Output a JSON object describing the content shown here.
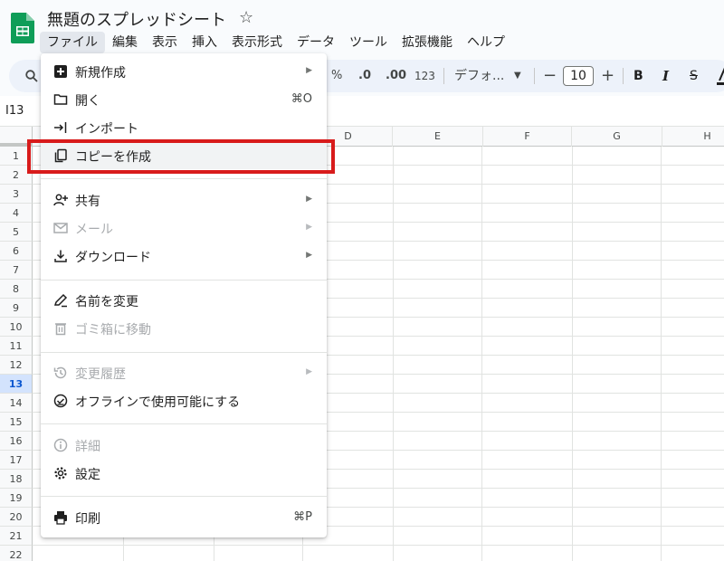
{
  "app": {
    "title": "無題のスプレッドシート",
    "brand_color": "#0f9d58"
  },
  "menubar": {
    "items": [
      "ファイル",
      "編集",
      "表示",
      "挿入",
      "表示形式",
      "データ",
      "ツール",
      "拡張機能",
      "ヘルプ"
    ]
  },
  "toolbar": {
    "percent": "%",
    "decrease_decimal": ".0",
    "increase_decimal": ".00",
    "number_format": "123",
    "font_name": "デフォ...",
    "font_size": "10",
    "bold": "B",
    "italic": "I",
    "strikethrough": "S",
    "minus": "−",
    "plus": "+"
  },
  "formula_bar": {
    "cell_ref": "I13"
  },
  "grid": {
    "columns": [
      "D",
      "E",
      "F",
      "G",
      "H"
    ],
    "rows": [
      "1",
      "2",
      "3",
      "4",
      "5",
      "6",
      "7",
      "8",
      "9",
      "10",
      "11",
      "12",
      "13",
      "14",
      "15",
      "16",
      "17",
      "18",
      "19",
      "20",
      "21",
      "22"
    ],
    "selected_row": "13"
  },
  "file_menu": {
    "items": [
      {
        "label": "新規作成",
        "icon": "new-icon",
        "submenu": true,
        "disabled": false
      },
      {
        "label": "開く",
        "icon": "folder-icon",
        "shortcut": "⌘O",
        "disabled": false
      },
      {
        "label": "インポート",
        "icon": "import-icon",
        "disabled": false
      },
      {
        "label": "コピーを作成",
        "icon": "copy-icon",
        "disabled": false,
        "highlighted": true
      },
      {
        "label": "共有",
        "icon": "share-icon",
        "submenu": true,
        "disabled": false
      },
      {
        "label": "メール",
        "icon": "mail-icon",
        "submenu": true,
        "disabled": true
      },
      {
        "label": "ダウンロード",
        "icon": "download-icon",
        "submenu": true,
        "disabled": false
      },
      {
        "label": "名前を変更",
        "icon": "rename-icon",
        "disabled": false
      },
      {
        "label": "ゴミ箱に移動",
        "icon": "trash-icon",
        "disabled": true
      },
      {
        "label": "変更履歴",
        "icon": "history-icon",
        "submenu": true,
        "disabled": true
      },
      {
        "label": "オフラインで使用可能にする",
        "icon": "offline-icon",
        "disabled": false
      },
      {
        "label": "詳細",
        "icon": "info-icon",
        "disabled": true
      },
      {
        "label": "設定",
        "icon": "gear-icon",
        "disabled": false
      },
      {
        "label": "印刷",
        "icon": "print-icon",
        "shortcut": "⌘P",
        "disabled": false
      }
    ]
  },
  "annotation": {
    "highlight_color": "#d81b1b"
  }
}
